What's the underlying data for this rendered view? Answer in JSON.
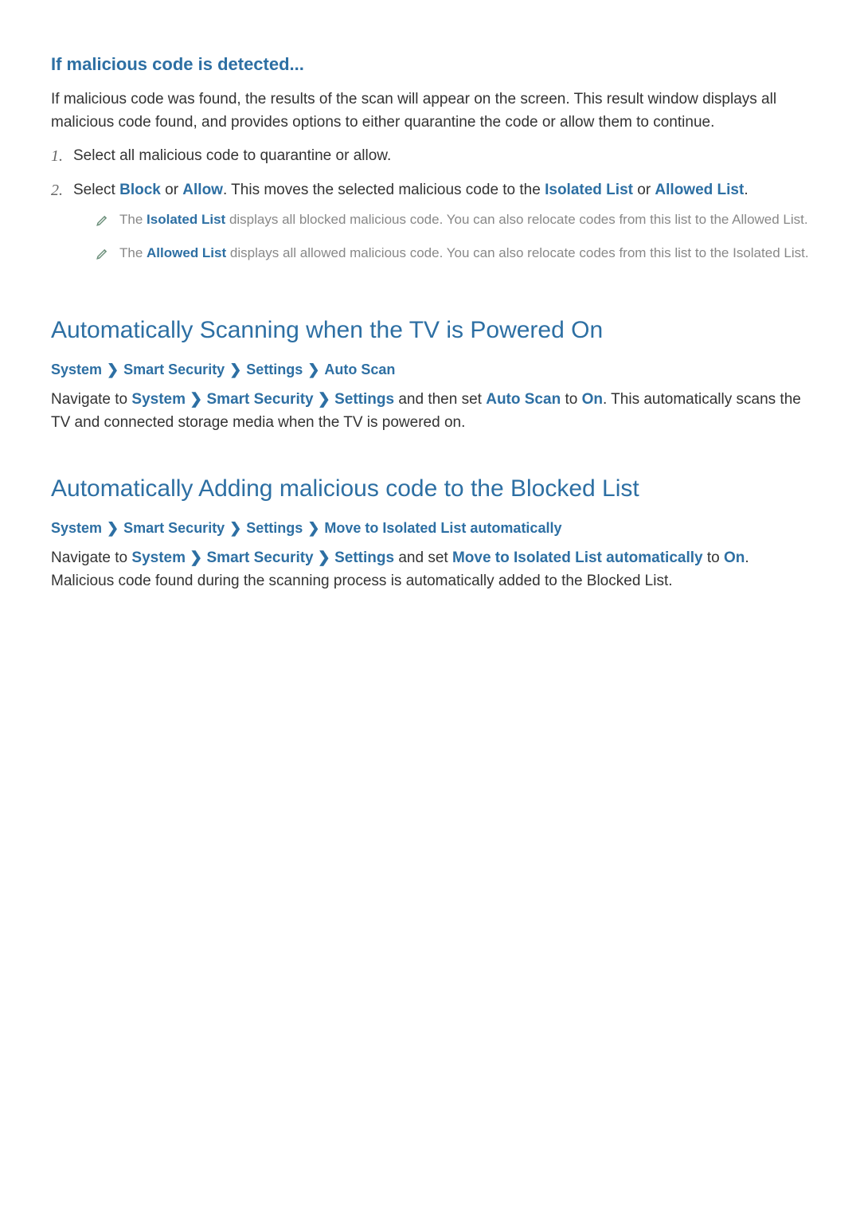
{
  "intro": {
    "heading": "If malicious code is detected...",
    "paragraph": "If malicious code was found, the results of the scan will appear on the screen. This result window displays all malicious code found, and provides options to either quarantine the code or allow them to continue."
  },
  "steps": [
    {
      "num": "1.",
      "text_plain": "Select all malicious code to quarantine or allow."
    },
    {
      "num": "2.",
      "prefix": "Select ",
      "block": "Block",
      "or": " or ",
      "allow": "Allow",
      "mid": ". This moves the selected malicious code to the ",
      "isolated": "Isolated List",
      "or2": " or ",
      "allowed": "Allowed List",
      "suffix": ".",
      "notes": [
        {
          "lead_bold": "Isolated List",
          "pre": "The ",
          "rest": " displays all blocked malicious code. You can also relocate codes from this list to the Allowed List."
        },
        {
          "lead_bold": "Allowed List",
          "pre": "The ",
          "rest": " displays all allowed malicious code. You can also relocate codes from this list to the Isolated List."
        }
      ]
    }
  ],
  "section_auto_scan": {
    "title": "Automatically Scanning when the TV is Powered On",
    "breadcrumb": [
      "System",
      "Smart Security",
      "Settings",
      "Auto Scan"
    ],
    "para_pre": "Navigate to ",
    "nav": [
      "System",
      "Smart Security",
      "Settings"
    ],
    "mid1": " and then set ",
    "setting": "Auto Scan",
    "mid2": " to ",
    "value": "On",
    "tail": ". This automatically scans the TV and connected storage media when the TV is powered on."
  },
  "section_blocked": {
    "title": "Automatically Adding malicious code to the Blocked List",
    "breadcrumb": [
      "System",
      "Smart Security",
      "Settings",
      "Move to Isolated List automatically"
    ],
    "para_pre": "Navigate to ",
    "nav": [
      "System",
      "Smart Security",
      "Settings"
    ],
    "mid1": " and set ",
    "setting": "Move to Isolated List automatically",
    "mid2": " to ",
    "value": "On",
    "tail": ". Malicious code found during the scanning process is automatically added to the Blocked List."
  },
  "glyphs": {
    "chevron": "❯"
  }
}
